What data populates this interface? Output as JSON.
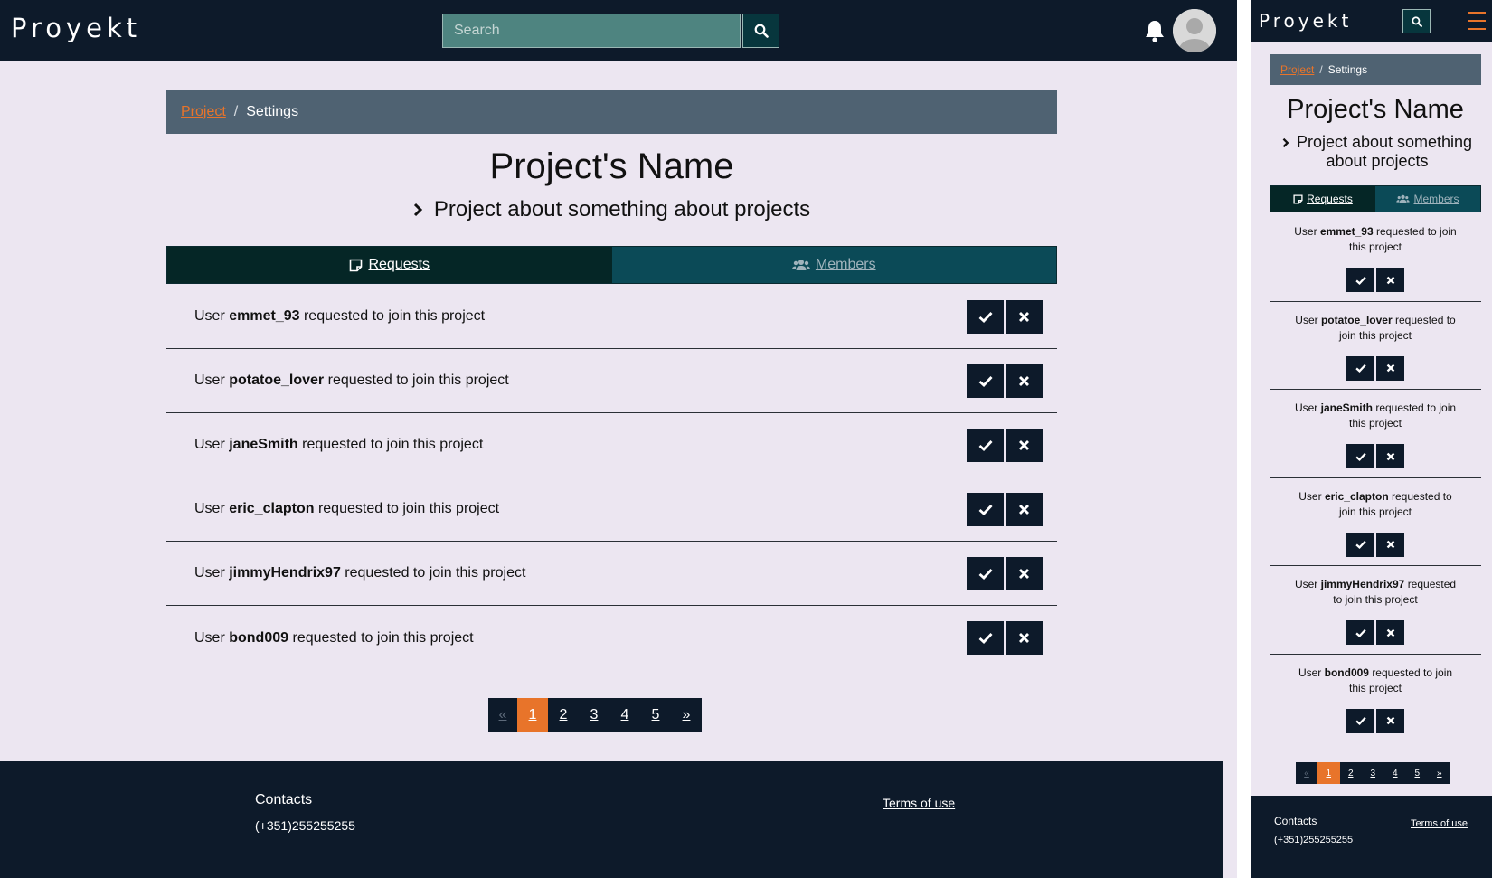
{
  "app": {
    "logo": "Proyekt"
  },
  "search": {
    "placeholder": "Search"
  },
  "breadcrumb": {
    "parent": "Project",
    "separator": "/",
    "current": "Settings"
  },
  "project": {
    "name": "Project's Name",
    "description": "Project about something about projects"
  },
  "tabs": [
    {
      "label": "Requests",
      "icon": "edit-square-icon",
      "active": true
    },
    {
      "label": "Members",
      "icon": "users-icon",
      "active": false
    }
  ],
  "requests": [
    {
      "prefix": "User",
      "username": "emmet_93",
      "suffix": "requested to join this project"
    },
    {
      "prefix": "User",
      "username": "potatoe_lover",
      "suffix": "requested to join this project"
    },
    {
      "prefix": "User",
      "username": "janeSmith",
      "suffix": "requested to join this project"
    },
    {
      "prefix": "User",
      "username": "eric_clapton",
      "suffix": "requested to join this project"
    },
    {
      "prefix": "User",
      "username": "jimmyHendrix97",
      "suffix": "requested to join this project"
    },
    {
      "prefix": "User",
      "username": "bond009",
      "suffix": "requested to join this project"
    }
  ],
  "pagination": {
    "prev": "«",
    "next": "»",
    "pages": [
      "1",
      "2",
      "3",
      "4",
      "5"
    ],
    "current": "1"
  },
  "footer": {
    "contacts_title": "Contacts",
    "phone": "(+351)255255255",
    "terms": "Terms of use"
  },
  "colors": {
    "navbar": "#0d1a2a",
    "accent": "#e8742a",
    "page_bg": "#ece6f1",
    "breadcrumb_bg": "#4f6272",
    "tab_active": "#052626",
    "tab_inactive": "#0b4a57"
  }
}
